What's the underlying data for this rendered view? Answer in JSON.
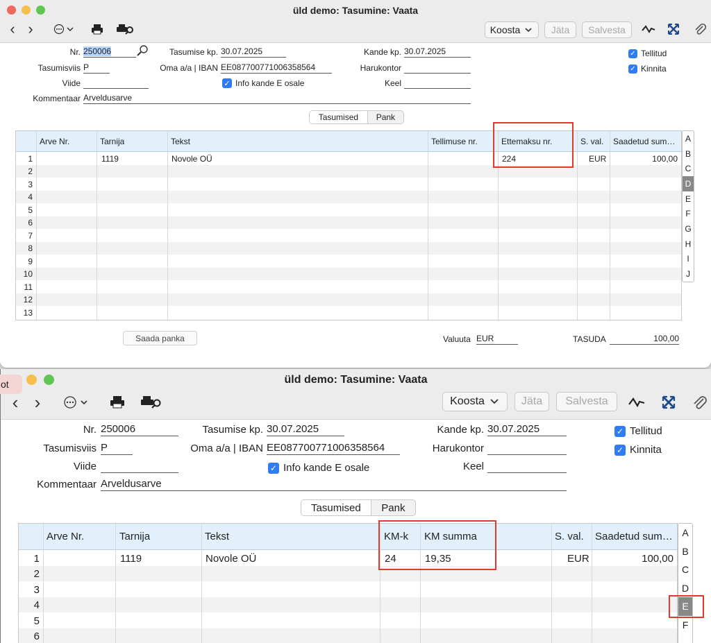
{
  "window_title": "üld demo: Tasumine: Vaata",
  "nav": {
    "back": "‹",
    "forward": "›"
  },
  "toolbar": {
    "koosta": "Koosta",
    "jata": "Jäta",
    "salvesta": "Salvesta"
  },
  "icons": {
    "more": "more-icon",
    "print": "print-icon",
    "print_search": "print-preview-icon",
    "graph": "activity-icon",
    "expand": "expand-icon",
    "attach": "paperclip-icon",
    "search": "search-icon"
  },
  "colors": {
    "accent": "#2f7cf6",
    "highlight": "#e03a2f",
    "header_bg": "#e1f0fb",
    "close": "#ed6a5e",
    "minimize": "#f5bf4f",
    "zoom": "#61c554"
  },
  "form": {
    "nr_label": "Nr.",
    "nr_value": "250006",
    "tasumise_kp_label": "Tasumise kp.",
    "tasumise_kp_value": "30.07.2025",
    "kande_kp_label": "Kande kp.",
    "kande_kp_value": "30.07.2025",
    "tasumisviis_label": "Tasumisviis",
    "tasumisviis_value": "P",
    "oma_iban_label": "Oma a/a | IBAN",
    "oma_iban_value": "EE087700771006358564",
    "harukontor_label": "Harukontor",
    "harukontor_value": "",
    "viide_label": "Viide",
    "viide_value": "",
    "info_kande_label": "Info kande E osale",
    "keel_label": "Keel",
    "keel_value": "",
    "kommentaar_label": "Kommentaar",
    "kommentaar_value": "Arveldusarve",
    "tellitud_label": "Tellitud",
    "kinnita_label": "Kinnita"
  },
  "tabs": {
    "tasumised": "Tasumised",
    "pank": "Pank"
  },
  "grid1": {
    "headers": [
      "Arve Nr.",
      "Tarnija",
      "Tekst",
      "Tellimuse nr.",
      "Ettemaksu nr.",
      "S. val.",
      "Saadetud sum…"
    ],
    "row1": {
      "num": "1",
      "tarnija": "1119",
      "tekst": "Novole OÜ",
      "ettemaks": "224",
      "val": "EUR",
      "sum": "100,00"
    },
    "row_numbers": [
      "1",
      "2",
      "3",
      "4",
      "5",
      "6",
      "7",
      "8",
      "9",
      "10",
      "11",
      "12",
      "13"
    ]
  },
  "grid2": {
    "headers": [
      "Arve Nr.",
      "Tarnija",
      "Tekst",
      "KM-k",
      "KM summa",
      "S. val.",
      "Saadetud sum…"
    ],
    "row1": {
      "num": "1",
      "tarnija": "1119",
      "tekst": "Novole OÜ",
      "kmk": "24",
      "kmsumma": "19,35",
      "val": "EUR",
      "sum": "100,00"
    },
    "row_numbers": [
      "1",
      "2",
      "3",
      "4",
      "5",
      "6"
    ]
  },
  "letters": [
    "A",
    "B",
    "C",
    "D",
    "E",
    "F",
    "G",
    "H",
    "I",
    "J"
  ],
  "footer": {
    "saada_panka": "Saada panka",
    "valuuta_label": "Valuuta",
    "valuuta_value": "EUR",
    "tasuda_label": "TASUDA",
    "tasuda_value": "100,00"
  },
  "overlay_tag": "ot"
}
